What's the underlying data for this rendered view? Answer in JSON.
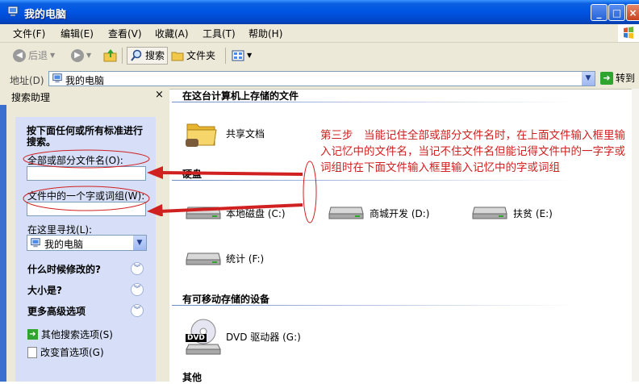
{
  "window": {
    "title": "我的电脑"
  },
  "menu": [
    "文件(F)",
    "编辑(E)",
    "查看(V)",
    "收藏(A)",
    "工具(T)",
    "帮助(H)"
  ],
  "toolbar": {
    "back": "后退",
    "search": "搜索",
    "folders": "文件夹"
  },
  "address": {
    "label": "地址(D)",
    "value": "我的电脑",
    "go": "转到"
  },
  "search_pane": {
    "title": "搜索助理",
    "heading": "按下面任何或所有标准进行搜索。",
    "filename_label": "全部或部分文件名(O):",
    "filename_value": "",
    "phrase_label": "文件中的一个字或词组(W):",
    "phrase_value": "",
    "lookin_label": "在这里寻找(L):",
    "lookin_value": "我的电脑",
    "options": [
      {
        "label": "什么时候修改的?"
      },
      {
        "label": "大小是?"
      },
      {
        "label": "更多高级选项"
      }
    ],
    "links": [
      {
        "label": "其他搜索选项(S)"
      },
      {
        "label": "改变首选项(G)"
      }
    ]
  },
  "content": {
    "sections": [
      {
        "title": "在这台计算机上存储的文件"
      },
      {
        "title": "硬盘"
      },
      {
        "title": "有可移动存储的设备"
      },
      {
        "title": "其他"
      }
    ],
    "shared_docs": "共享文档",
    "drives": [
      {
        "label": "本地磁盘 (C:)"
      },
      {
        "label": "商城开发 (D:)"
      },
      {
        "label": "扶贫 (E:)"
      },
      {
        "label": "统计 (F:)"
      }
    ],
    "dvd": "DVD 驱动器 (G:)",
    "dvd_badge": "DVD"
  },
  "annotation": "第三步　当能记住全部或部分文件名时，在上面文件输入框里输入记忆中的文件名，当记不住文件名但能记得文件中的一字字或词组时在下面文件输入框里输入记忆中的字或词组",
  "colors": {
    "annotation": "#d02020",
    "titlebar": "#0054e3",
    "pane": "#d6dff7"
  }
}
